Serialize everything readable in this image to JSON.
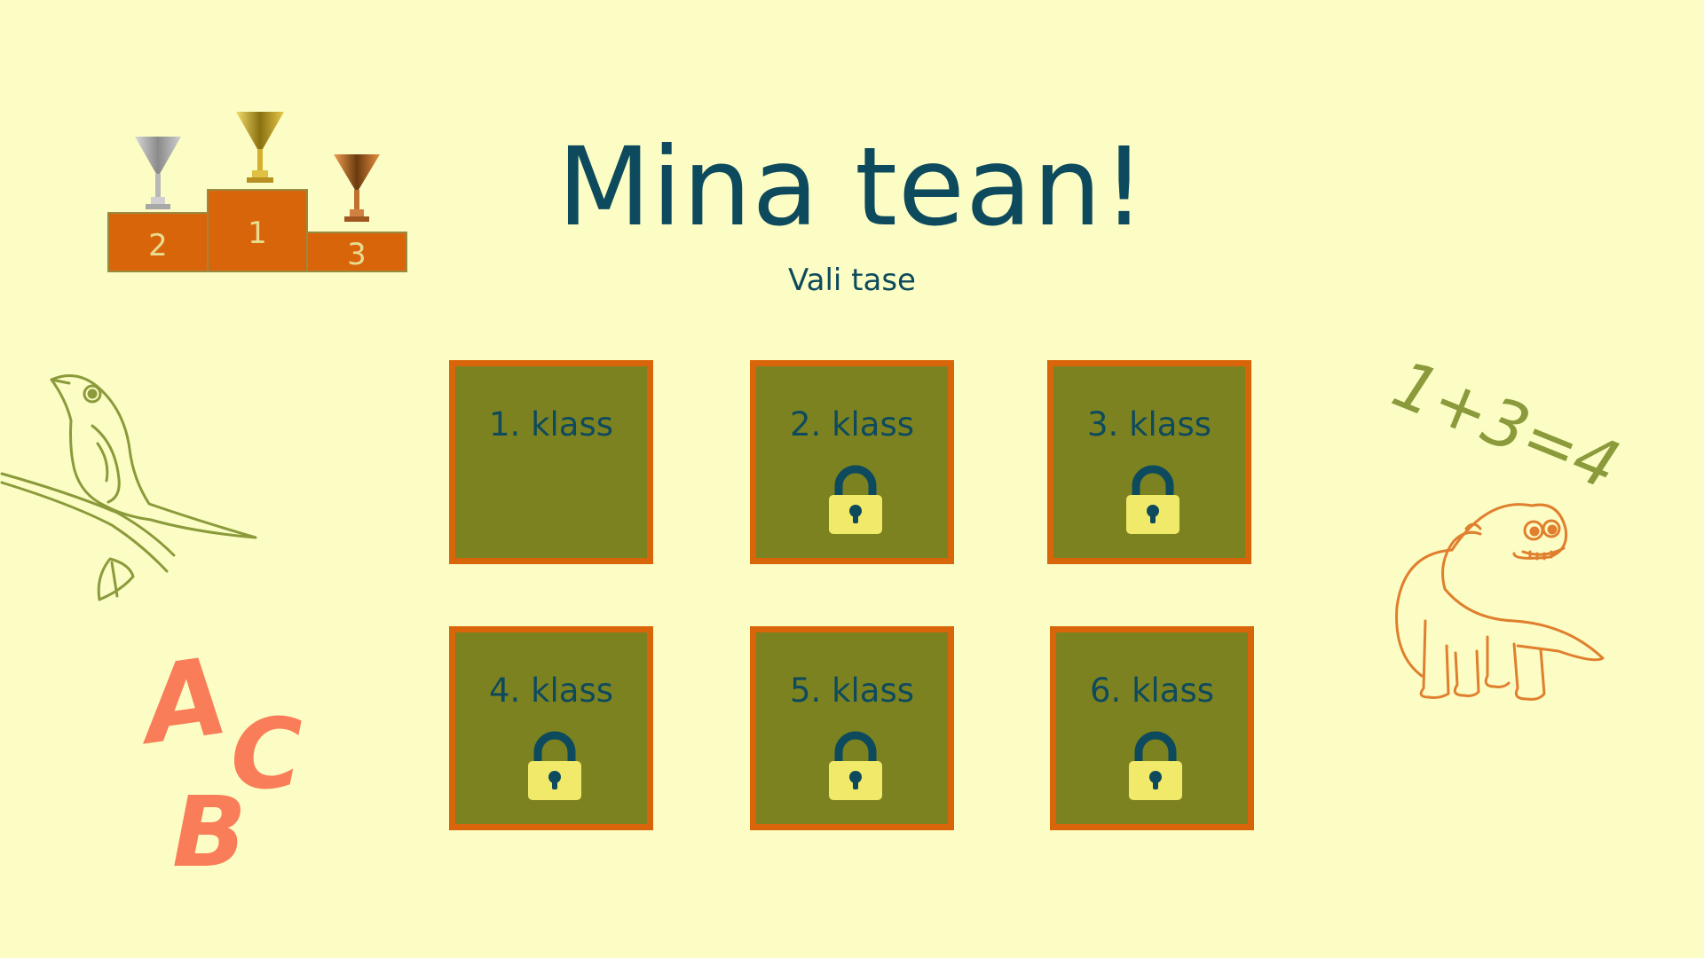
{
  "title": "Mina tean!",
  "subtitle": "Vali tase",
  "podium": {
    "first": "1",
    "second": "2",
    "third": "3"
  },
  "math_doodle": "1+3=4",
  "abc_doodle": {
    "a": "A",
    "b": "B",
    "c": "C"
  },
  "levels": [
    {
      "label": "1. klass",
      "locked": false
    },
    {
      "label": "2. klass",
      "locked": true
    },
    {
      "label": "3. klass",
      "locked": true
    },
    {
      "label": "4. klass",
      "locked": true
    },
    {
      "label": "5. klass",
      "locked": true
    },
    {
      "label": "6. klass",
      "locked": true
    }
  ],
  "colors": {
    "background": "#fbfdc4",
    "tile": "#7d8220",
    "tile_border": "#d9650a",
    "text": "#0e4a5d",
    "lock_body": "#f0e96a",
    "doodle_green": "#8b9a3a",
    "doodle_orange": "#e07f2e",
    "abc": "#f97d58"
  }
}
